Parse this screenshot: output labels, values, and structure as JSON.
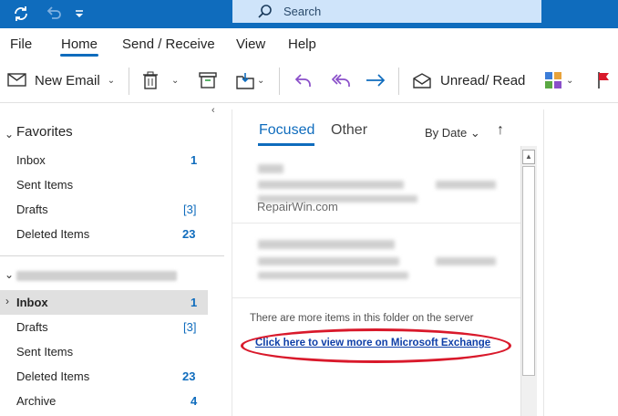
{
  "titlebar": {
    "search_placeholder": "Search",
    "color": "#0f6cbd"
  },
  "menu": {
    "tabs": [
      {
        "label": "File"
      },
      {
        "label": "Home"
      },
      {
        "label": "Send / Receive"
      },
      {
        "label": "View"
      },
      {
        "label": "Help"
      }
    ],
    "active_tab": "Home"
  },
  "ribbon": {
    "new_email": "New Email",
    "unread_read": "Unread/ Read"
  },
  "favorites": {
    "header": "Favorites",
    "items": [
      {
        "label": "Inbox",
        "count": "1"
      },
      {
        "label": "Sent Items",
        "count": ""
      },
      {
        "label": "Drafts",
        "count": "[3]"
      },
      {
        "label": "Deleted Items",
        "count": "23"
      }
    ]
  },
  "account": {
    "items": [
      {
        "label": "Inbox",
        "count": "1"
      },
      {
        "label": "Drafts",
        "count": "[3]"
      },
      {
        "label": "Sent Items",
        "count": ""
      },
      {
        "label": "Deleted Items",
        "count": "23"
      },
      {
        "label": "Archive",
        "count": "4"
      }
    ]
  },
  "messages": {
    "tab_focused": "Focused",
    "tab_other": "Other",
    "sort": "By Date",
    "sort_arrow": "↑",
    "watermark": "RepairWin.com",
    "server_note": "There are more items in this folder on the server",
    "server_link": "Click here to view more on Microsoft Exchange"
  }
}
